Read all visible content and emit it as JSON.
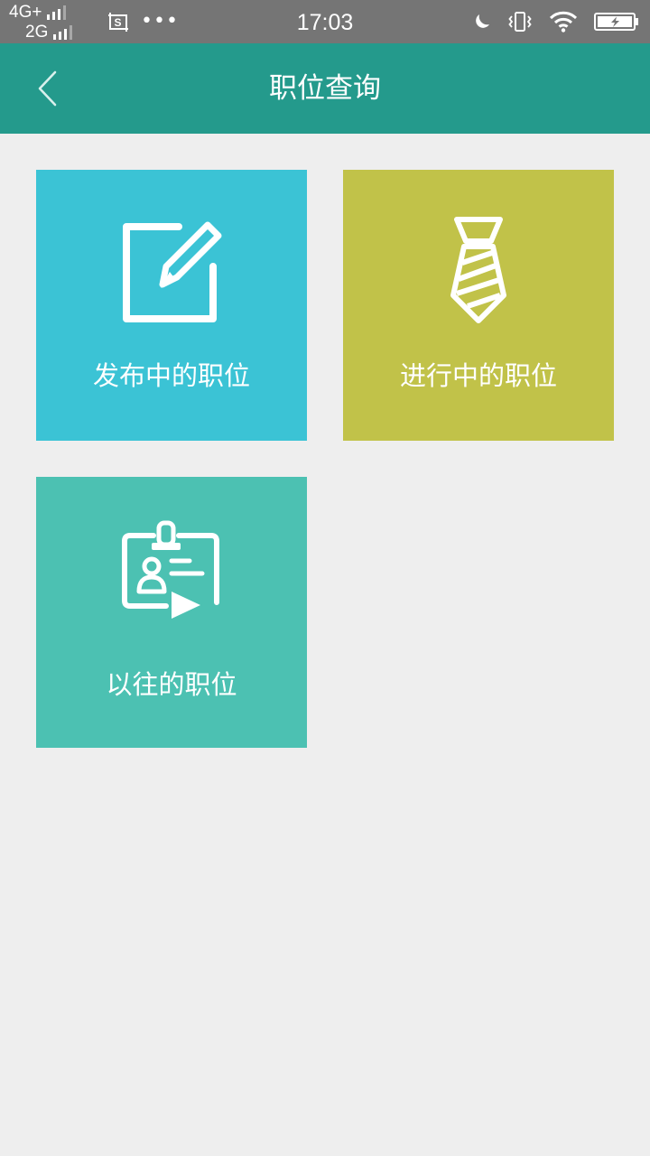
{
  "status_bar": {
    "network_primary": "4G+",
    "network_secondary": "2G",
    "time": "17:03",
    "overflow_indicator": "•••"
  },
  "header": {
    "title": "职位查询",
    "back_icon": "chevron-left-icon"
  },
  "tiles": [
    {
      "label": "发布中的职位",
      "icon": "edit-icon",
      "color": "#3bc3d5"
    },
    {
      "label": "进行中的职位",
      "icon": "tie-icon",
      "color": "#c1c249"
    },
    {
      "label": "以往的职位",
      "icon": "badge-play-icon",
      "color": "#4cc1b2"
    }
  ],
  "colors": {
    "status_bar": "#757575",
    "app_bar": "#249a8c",
    "background": "#eeeeee"
  }
}
